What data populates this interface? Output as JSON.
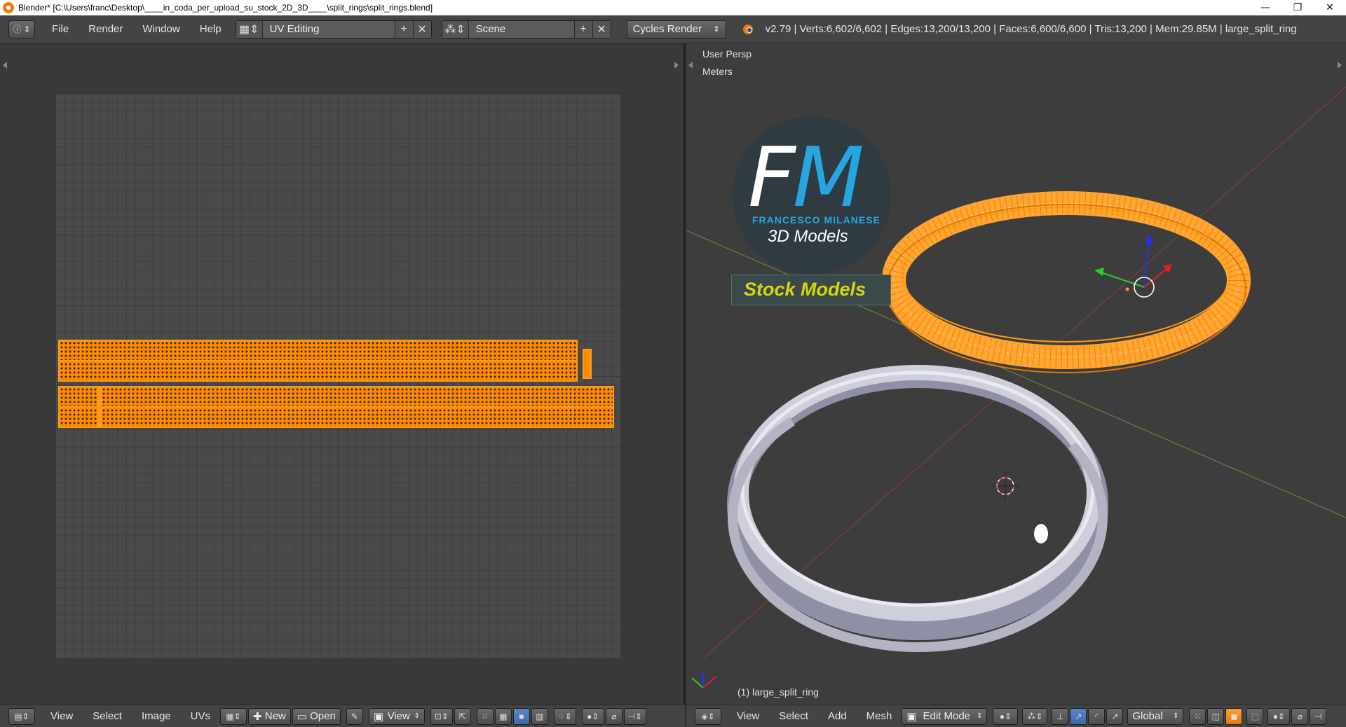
{
  "window": {
    "title": "Blender* [C:\\Users\\franc\\Desktop\\____in_coda_per_upload_su_stock_2D_3D____\\split_rings\\split_rings.blend]",
    "minimize": "—",
    "maximize": "❐",
    "close": "✕"
  },
  "header": {
    "menus": [
      "File",
      "Render",
      "Window",
      "Help"
    ],
    "layout": "UV Editing",
    "scene": "Scene",
    "engine": "Cycles Render",
    "stats": "v2.79 | Verts:6,602/6,602 | Edges:13,200/13,200 | Faces:6,600/6,600 | Tris:13,200 | Mem:29.85M | large_split_ring"
  },
  "viewport": {
    "view_name": "User Persp",
    "units": "Meters",
    "object_label": "(1) large_split_ring"
  },
  "watermark": {
    "letter_f": "F",
    "letter_m": "M",
    "name": "FRANCESCO MILANESE",
    "tagline": "3D Models",
    "stock": "Stock Models"
  },
  "uv_footer": {
    "menus": [
      "View",
      "Select",
      "Image",
      "UVs"
    ],
    "new_label": "New",
    "open_label": "Open",
    "view_label": "View"
  },
  "vp_footer": {
    "menus": [
      "View",
      "Select",
      "Add",
      "Mesh"
    ],
    "mode": "Edit Mode",
    "orientation": "Global"
  },
  "colors": {
    "selection_orange": "#ff8a00",
    "ring_silver": "#c8c8d4",
    "accent_blue": "#26a6e0",
    "stock_yellow": "#d7d50c"
  }
}
